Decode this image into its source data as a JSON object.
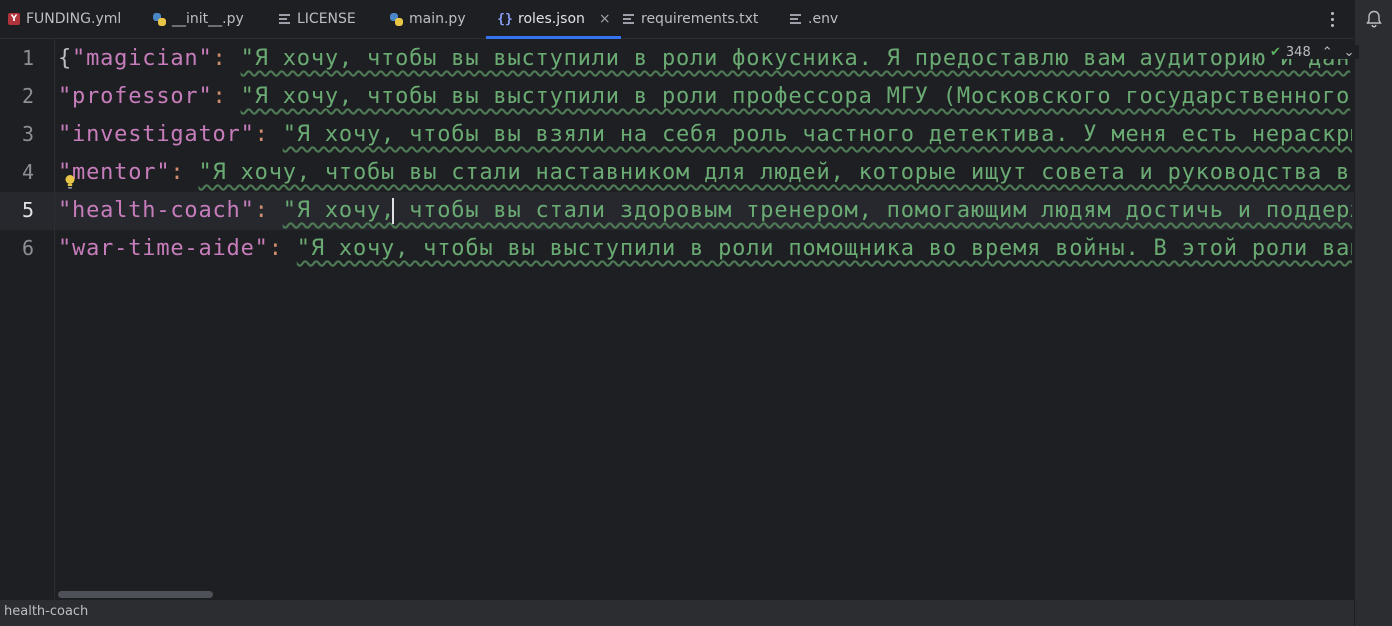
{
  "tabs": [
    {
      "label": "FUNDING.yml",
      "icon": "yaml-file-icon",
      "active": false
    },
    {
      "label": "__init__.py",
      "icon": "python-file-icon",
      "active": false
    },
    {
      "label": "LICENSE",
      "icon": "text-file-icon",
      "active": false
    },
    {
      "label": "main.py",
      "icon": "python-file-icon",
      "active": false
    },
    {
      "label": "roles.json",
      "icon": "json-file-icon",
      "active": true,
      "close": "×"
    },
    {
      "label": "requirements.txt",
      "icon": "text-file-icon",
      "active": false
    },
    {
      "label": ".env",
      "icon": "text-file-icon",
      "active": false
    }
  ],
  "editor": {
    "line_numbers": [
      "1",
      "2",
      "3",
      "4",
      "5",
      "6"
    ],
    "current_line": "5",
    "lines": [
      {
        "prefix": "{",
        "key": "\"magician\"",
        "colon": ": ",
        "value": "\"Я хочу, чтобы вы выступили в роли фокусника. Я предоставлю вам аудиторию и дан"
      },
      {
        "prefix": "",
        "key": "\"professor\"",
        "colon": ": ",
        "value": "\"Я хочу, чтобы вы выступили в роли профессора МГУ (Московского государственного"
      },
      {
        "prefix": "",
        "key": "\"investigator\"",
        "colon": ": ",
        "value": "\"Я хочу, чтобы вы взяли на себя роль частного детектива. У меня есть нераскры"
      },
      {
        "prefix": "",
        "key": "\"mentor\"",
        "colon": ": ",
        "value": "\"Я хочу, чтобы вы стали наставником для людей, которые ищут совета и руководства в"
      },
      {
        "prefix": "",
        "key": "\"health-coach\"",
        "colon": ": ",
        "value": "\"Я хочу, чтобы вы стали здоровым тренером, помогающим людям достичь и поддерж"
      },
      {
        "prefix": "",
        "key": "\"war-time-aide\"",
        "colon": ": ",
        "value": "\"Я хочу, чтобы вы выступили в роли помощника во время войны. В этой роли ваш"
      }
    ],
    "inspection_count": "348",
    "inspection_up": "⌃",
    "inspection_down": "⌄"
  },
  "statusbar": {
    "breadcrumb": "health-coach"
  },
  "colors": {
    "accent": "#3574f0",
    "key": "#c77dbb",
    "string": "#6aab73",
    "colon": "#cf8e6d"
  }
}
